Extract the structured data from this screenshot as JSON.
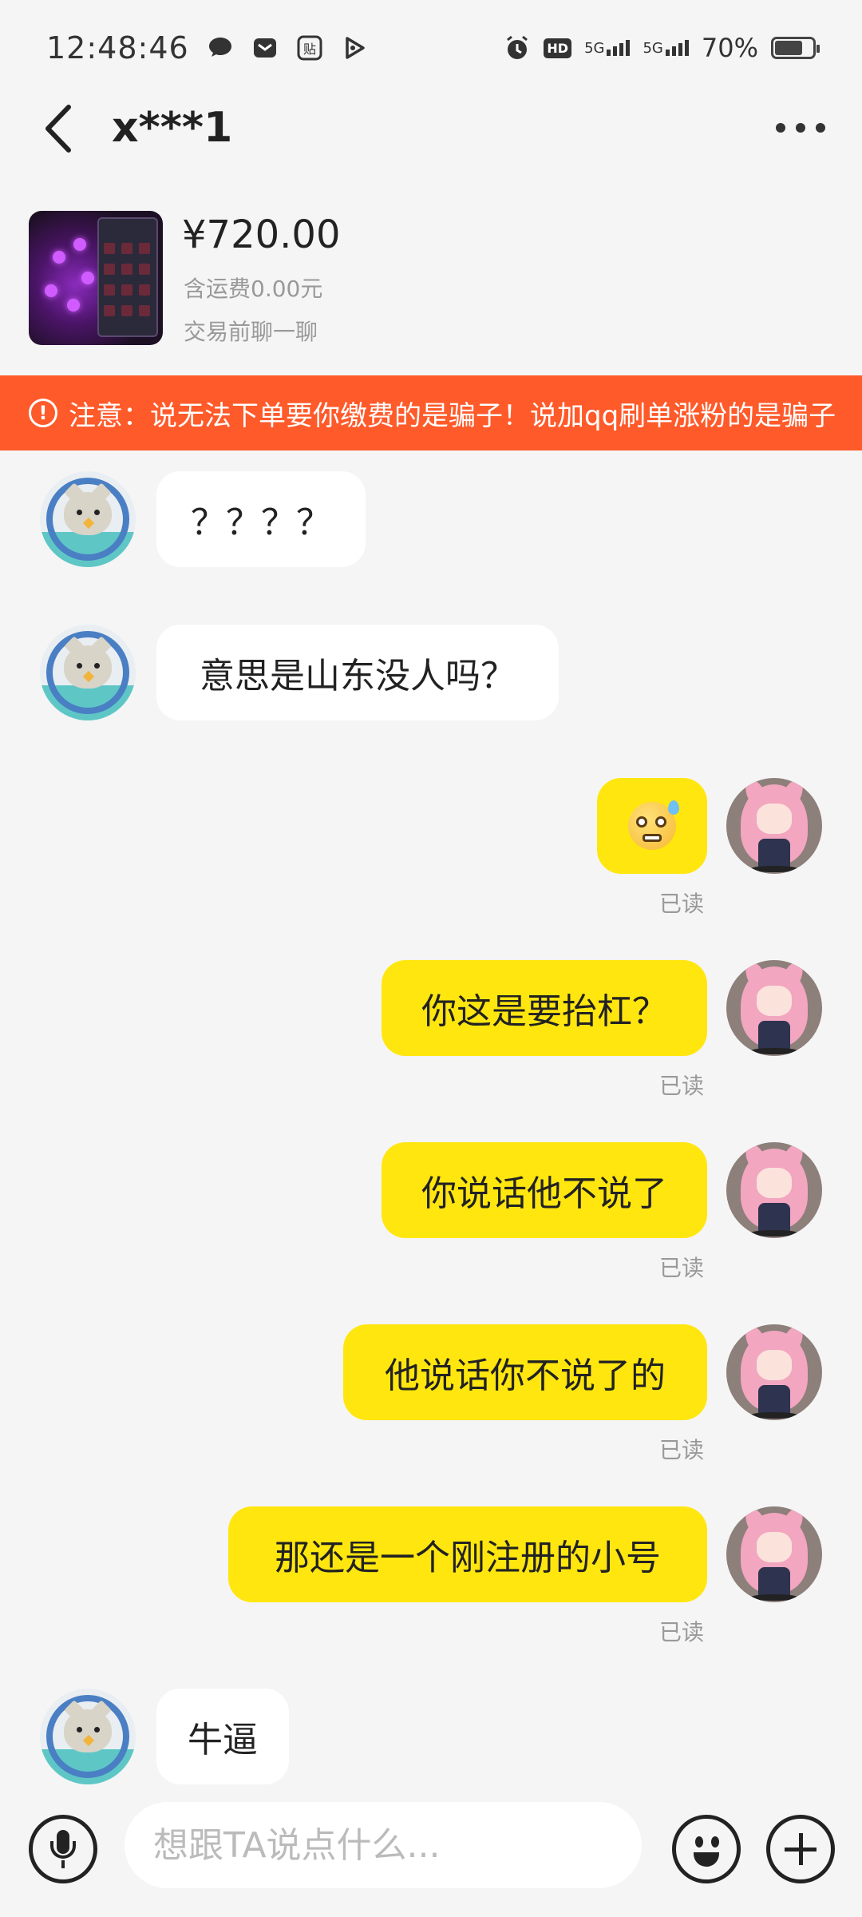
{
  "status_bar": {
    "time": "12:48:46",
    "battery": "70%",
    "network_1": "5G",
    "network_2": "5G",
    "hd": "HD"
  },
  "header": {
    "title": "x***1"
  },
  "product": {
    "price": "¥720.00",
    "shipping": "含运费0.00元",
    "hint": "交易前聊一聊"
  },
  "warning": {
    "text": "注意：说无法下单要你缴费的是骗子！说加qq刷单涨粉的是骗子"
  },
  "messages": [
    {
      "side": "in",
      "text": "？？？？"
    },
    {
      "side": "in",
      "text": "意思是山东没人吗？"
    },
    {
      "side": "out",
      "emoji": "anxious-sweat-face",
      "read": "已读"
    },
    {
      "side": "out",
      "text": "你这是要抬杠？",
      "read": "已读"
    },
    {
      "side": "out",
      "text": "你说话他不说了",
      "read": "已读"
    },
    {
      "side": "out",
      "text": "他说话你不说了的",
      "read": "已读"
    },
    {
      "side": "out",
      "text": "那还是一个刚注册的小号",
      "read": "已读"
    },
    {
      "side": "in",
      "text": "牛逼"
    }
  ],
  "input": {
    "placeholder": "想跟TA说点什么..."
  },
  "colors": {
    "warning_bg": "#ff5a2a",
    "outgoing_bubble": "#ffe60f",
    "incoming_bubble": "#ffffff",
    "background": "#f5f5f5"
  }
}
